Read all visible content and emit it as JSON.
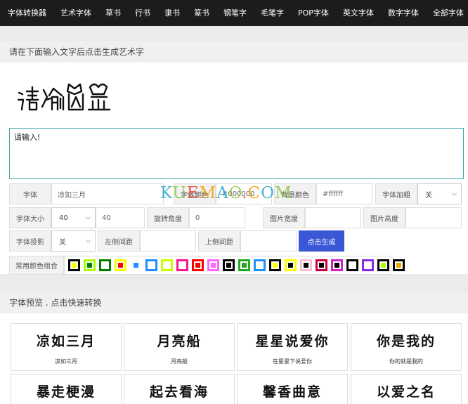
{
  "nav": {
    "items": [
      "字体转换器",
      "艺术字体",
      "草书",
      "行书",
      "隶书",
      "篆书",
      "钢笔字",
      "毛笔字",
      "POP字体",
      "英文字体",
      "数字字体",
      "全部字体"
    ]
  },
  "generator": {
    "heading": "请在下面输入文字后点击生成艺术字",
    "preview_text": "请输入!",
    "textarea_value": "请输入!",
    "labels": {
      "font": "字体",
      "font_color": "字体颜色",
      "bg_color": "背景颜色",
      "bold": "字体加粗",
      "font_size": "字体大小",
      "rotate": "旋转角度",
      "img_width": "图片宽度",
      "img_height": "图片高度",
      "shadow": "字体投影",
      "left_margin": "左侧间距",
      "top_margin": "上侧间距",
      "common_colors": "常用颜色组合"
    },
    "values": {
      "font": "凉如三月",
      "font_color": "#000000",
      "bg_color": "#ffffff",
      "bold": "关",
      "font_size_select": "40",
      "font_size_input": "40",
      "rotate": "0",
      "img_width": "",
      "img_height": "",
      "shadow": "关",
      "left_margin": "",
      "top_margin": ""
    },
    "generate_button": "点击生成",
    "color_swatches": [
      {
        "border": "#000000",
        "fill": "#ffff00"
      },
      {
        "border": "#aaff00",
        "fill": "#008000"
      },
      {
        "border": "#008000",
        "fill": "#ffffff"
      },
      {
        "border": "#ffff00",
        "fill": "#ff0000"
      },
      {
        "border": "#ffffff",
        "fill": "#1e90ff"
      },
      {
        "border": "#1e90ff",
        "fill": "#ffffff"
      },
      {
        "border": "#ccff00",
        "fill": "#ffffff"
      },
      {
        "border": "#ff1493",
        "fill": "#ffffff"
      },
      {
        "border": "#ff0000",
        "fill": "#ff0000"
      },
      {
        "border": "#ff66ff",
        "fill": "#ff66ff"
      },
      {
        "border": "#000000",
        "fill": "#000000"
      },
      {
        "border": "#22aa22",
        "fill": "#22aa22"
      },
      {
        "border": "#1e90ff",
        "fill": "#ffffff"
      },
      {
        "border": "#000000",
        "fill": "#ffff00"
      },
      {
        "border": "#ffff00",
        "fill": "#000000"
      },
      {
        "border": "#ffc0cb",
        "fill": "#000000"
      },
      {
        "border": "#cc0044",
        "fill": "#000000"
      },
      {
        "border": "#cc22cc",
        "fill": "#000000"
      },
      {
        "border": "#000000",
        "fill": "#ffffff"
      },
      {
        "border": "#8a2be2",
        "fill": "#ffffff"
      },
      {
        "border": "#000000",
        "fill": "#aaff00"
      },
      {
        "border": "#000000",
        "fill": "#e6a800"
      }
    ]
  },
  "watermark": {
    "text": "KUEMAO.COM",
    "colors": [
      "#2aa6c9",
      "#8dc63f",
      "#e8463a",
      "#f2a100"
    ]
  },
  "fonts_section": {
    "heading": "字体预览 . 点击快速转换",
    "cards": [
      {
        "art": "凉如三月",
        "caption": "凉如三月"
      },
      {
        "art": "月亮船",
        "caption": "月亮船"
      },
      {
        "art": "星星说爱你",
        "caption": "在星星下说爱你"
      },
      {
        "art": "你是我的",
        "caption": "你的就是我的"
      },
      {
        "art": "暴走梗漫",
        "caption": ""
      },
      {
        "art": "起去看海",
        "caption": ""
      },
      {
        "art": "馨香曲意",
        "caption": ""
      },
      {
        "art": "以爱之名",
        "caption": ""
      }
    ]
  }
}
